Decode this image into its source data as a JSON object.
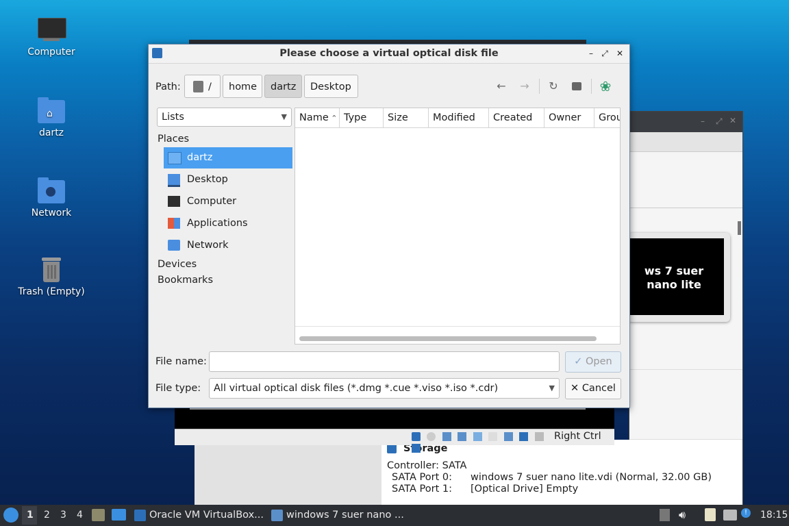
{
  "desktop": {
    "icons": [
      {
        "label": "Computer",
        "icon": "monitor-icon"
      },
      {
        "label": "dartz",
        "icon": "home-folder-icon"
      },
      {
        "label": "Network",
        "icon": "network-folder-icon"
      },
      {
        "label": "Trash (Empty)",
        "icon": "trash-icon"
      }
    ]
  },
  "background_window": {
    "vm_name_preview": "ws 7 suer nano lite",
    "statusbar_host_key": "Right Ctrl",
    "storage": {
      "heading": "Storage",
      "controller": "Controller: SATA",
      "port0_label": "SATA Port 0:",
      "port0_value": "windows 7 suer nano lite.vdi (Normal, 32.00 GB)",
      "port1_label": "SATA Port 1:",
      "port1_value": "[Optical Drive] Empty"
    }
  },
  "dialog": {
    "title": "Please choose a virtual optical disk file",
    "path_label": "Path:",
    "path_buttons": [
      "/",
      "home",
      "dartz",
      "Desktop"
    ],
    "active_path": "dartz",
    "view_mode": "Lists",
    "places_heading": "Places",
    "places": [
      {
        "label": "dartz",
        "icon": "home-icon",
        "selected": true
      },
      {
        "label": "Desktop",
        "icon": "desktop-icon",
        "selected": false
      },
      {
        "label": "Computer",
        "icon": "computer-icon",
        "selected": false
      },
      {
        "label": "Applications",
        "icon": "applications-icon",
        "selected": false
      },
      {
        "label": "Network",
        "icon": "network-icon",
        "selected": false
      }
    ],
    "devices_heading": "Devices",
    "bookmarks_heading": "Bookmarks",
    "columns": [
      "Name",
      "Type",
      "Size",
      "Modified",
      "Created",
      "Owner",
      "Grou"
    ],
    "filename_label": "File name:",
    "filename_value": "",
    "open_label": "Open",
    "filetype_label": "File type:",
    "filetype_value": "All virtual optical disk files (*.dmg *.cue *.viso *.iso *.cdr)",
    "cancel_label": "Cancel"
  },
  "taskbar": {
    "workspaces": [
      "1",
      "2",
      "3",
      "4"
    ],
    "active_workspace": "1",
    "tasks": [
      {
        "label": "Oracle VM VirtualBox..."
      },
      {
        "label": "windows 7 suer nano ..."
      }
    ],
    "clock": "18:15"
  },
  "colors": {
    "selection": "#4a9ff0",
    "taskbar": "#2b2e33",
    "accent_green": "#2f9a6a"
  }
}
